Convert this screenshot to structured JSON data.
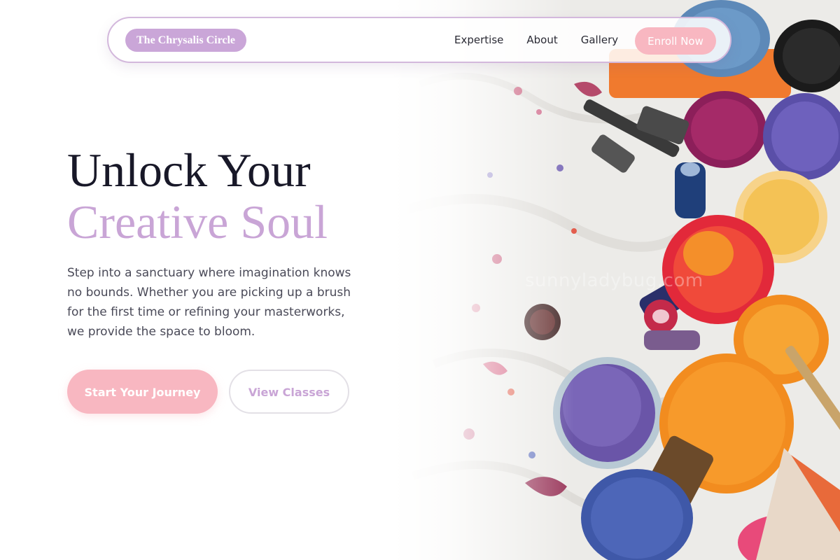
{
  "nav": {
    "brand": "The Chrysalis Circle",
    "links": [
      {
        "label": "Expertise"
      },
      {
        "label": "About"
      },
      {
        "label": "Gallery"
      }
    ],
    "cta_label": "Enroll Now"
  },
  "hero": {
    "title_line_1": "Unlock Your",
    "title_line_2": "Creative Soul",
    "description": "Step into a sanctuary where imagination knows no bounds. Whether you are picking up a brush for the first time or refining your masterworks, we provide the space to bloom.",
    "primary_button": "Start Your Journey",
    "secondary_button": "View Classes",
    "image_watermark": "sunnyladybug.com"
  },
  "colors": {
    "brand_lavender": "#c9a5d6",
    "accent_pink": "#f8b7c1",
    "heading_dark": "#181828",
    "body_text": "#4a4a58",
    "nav_border": "#d3b8dc"
  }
}
